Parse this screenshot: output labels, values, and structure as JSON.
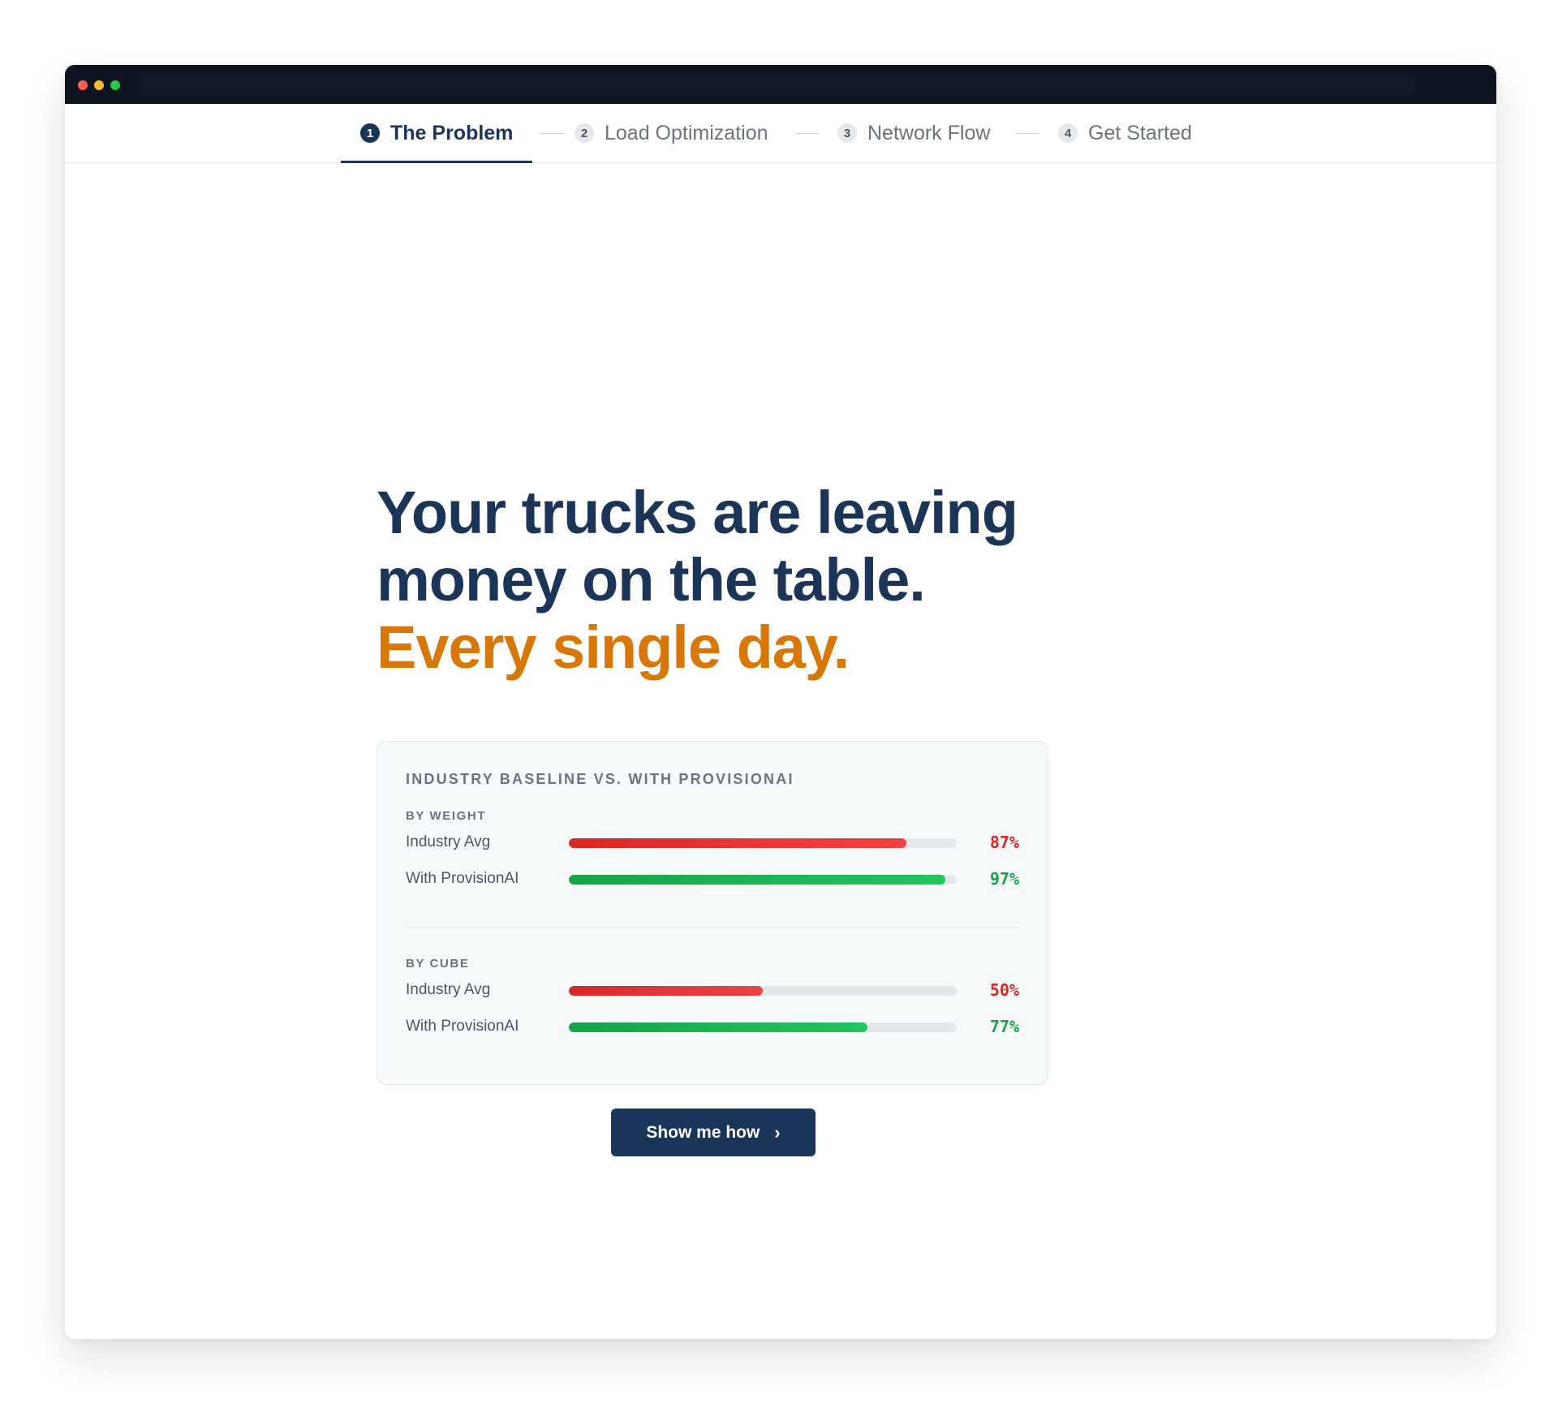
{
  "steps": [
    {
      "number": "1",
      "label": "The Problem"
    },
    {
      "number": "2",
      "label": "Load Optimization"
    },
    {
      "number": "3",
      "label": "Network Flow"
    },
    {
      "number": "4",
      "label": "Get Started"
    }
  ],
  "headline": {
    "line1": "Your trucks are leaving",
    "line2": "money on the table.",
    "accent": "Every single day."
  },
  "comparison": {
    "title": "INDUSTRY BASELINE VS. WITH PROVISIONAI",
    "sections": [
      {
        "label": "BY WEIGHT",
        "rows": [
          {
            "label": "Industry Avg",
            "value": 87,
            "display": "87%"
          },
          {
            "label": "With ProvisionAI",
            "value": 97,
            "display": "97%"
          }
        ]
      },
      {
        "label": "BY CUBE",
        "rows": [
          {
            "label": "Industry Avg",
            "value": 50,
            "display": "50%"
          },
          {
            "label": "With ProvisionAI",
            "value": 77,
            "display": "77%"
          }
        ]
      }
    ]
  },
  "cta": {
    "label": "Show me how",
    "icon": "chevron-right-icon"
  },
  "colors": {
    "brand_navy": "#1b3558",
    "accent_orange": "#d97706",
    "bar_red": "#dc2626",
    "bar_green": "#16a34a"
  }
}
